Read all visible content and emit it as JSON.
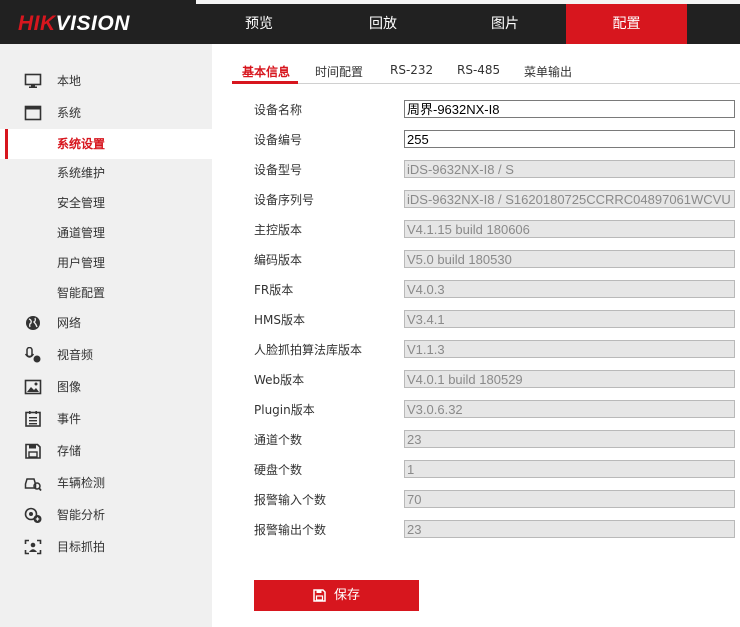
{
  "brand": {
    "hik": "HIK",
    "vision": "VISION"
  },
  "nav": [
    "预览",
    "回放",
    "图片",
    "配置"
  ],
  "sidebar": [
    {
      "label": "本地",
      "icon": "monitor-icon"
    },
    {
      "label": "系统",
      "icon": "system-window-icon"
    },
    {
      "label": "系统设置",
      "sub": true,
      "active": true
    },
    {
      "label": "系统维护",
      "sub": true
    },
    {
      "label": "安全管理",
      "sub": true
    },
    {
      "label": "通道管理",
      "sub": true
    },
    {
      "label": "用户管理",
      "sub": true
    },
    {
      "label": "智能配置",
      "sub": true
    },
    {
      "label": "网络",
      "icon": "globe-icon"
    },
    {
      "label": "视音频",
      "icon": "microphone-icon"
    },
    {
      "label": "图像",
      "icon": "image-icon"
    },
    {
      "label": "事件",
      "icon": "event-list-icon"
    },
    {
      "label": "存储",
      "icon": "floppy-disk-icon"
    },
    {
      "label": "车辆检测",
      "icon": "vehicle-detect-icon"
    },
    {
      "label": "智能分析",
      "icon": "smart-analysis-icon"
    },
    {
      "label": "目标抓拍",
      "icon": "target-capture-icon"
    }
  ],
  "tabs": [
    "基本信息",
    "时间配置",
    "RS-232",
    "RS-485",
    "菜单输出"
  ],
  "form": [
    {
      "label": "设备名称",
      "value": "周界-9632NX-I8",
      "editable": true
    },
    {
      "label": "设备编号",
      "value": "255",
      "editable": true
    },
    {
      "label": "设备型号",
      "value": "iDS-9632NX-I8 / S"
    },
    {
      "label": "设备序列号",
      "value": "iDS-9632NX-I8 / S1620180725CCRRC04897061WCVU"
    },
    {
      "label": "主控版本",
      "value": "V4.1.15 build 180606"
    },
    {
      "label": "编码版本",
      "value": "V5.0 build 180530"
    },
    {
      "label": "FR版本",
      "value": "V4.0.3"
    },
    {
      "label": "HMS版本",
      "value": "V3.4.1"
    },
    {
      "label": "人脸抓拍算法库版本",
      "value": "V1.1.3"
    },
    {
      "label": "Web版本",
      "value": "V4.0.1 build 180529"
    },
    {
      "label": "Plugin版本",
      "value": "V3.0.6.32"
    },
    {
      "label": "通道个数",
      "value": "23"
    },
    {
      "label": "硬盘个数",
      "value": "1"
    },
    {
      "label": "报警输入个数",
      "value": "70"
    },
    {
      "label": "报警输出个数",
      "value": "23"
    }
  ],
  "save_label": "保存",
  "colors": {
    "accent": "#d7161e",
    "topbar": "#212121",
    "sidebar": "#f0f0f0"
  }
}
